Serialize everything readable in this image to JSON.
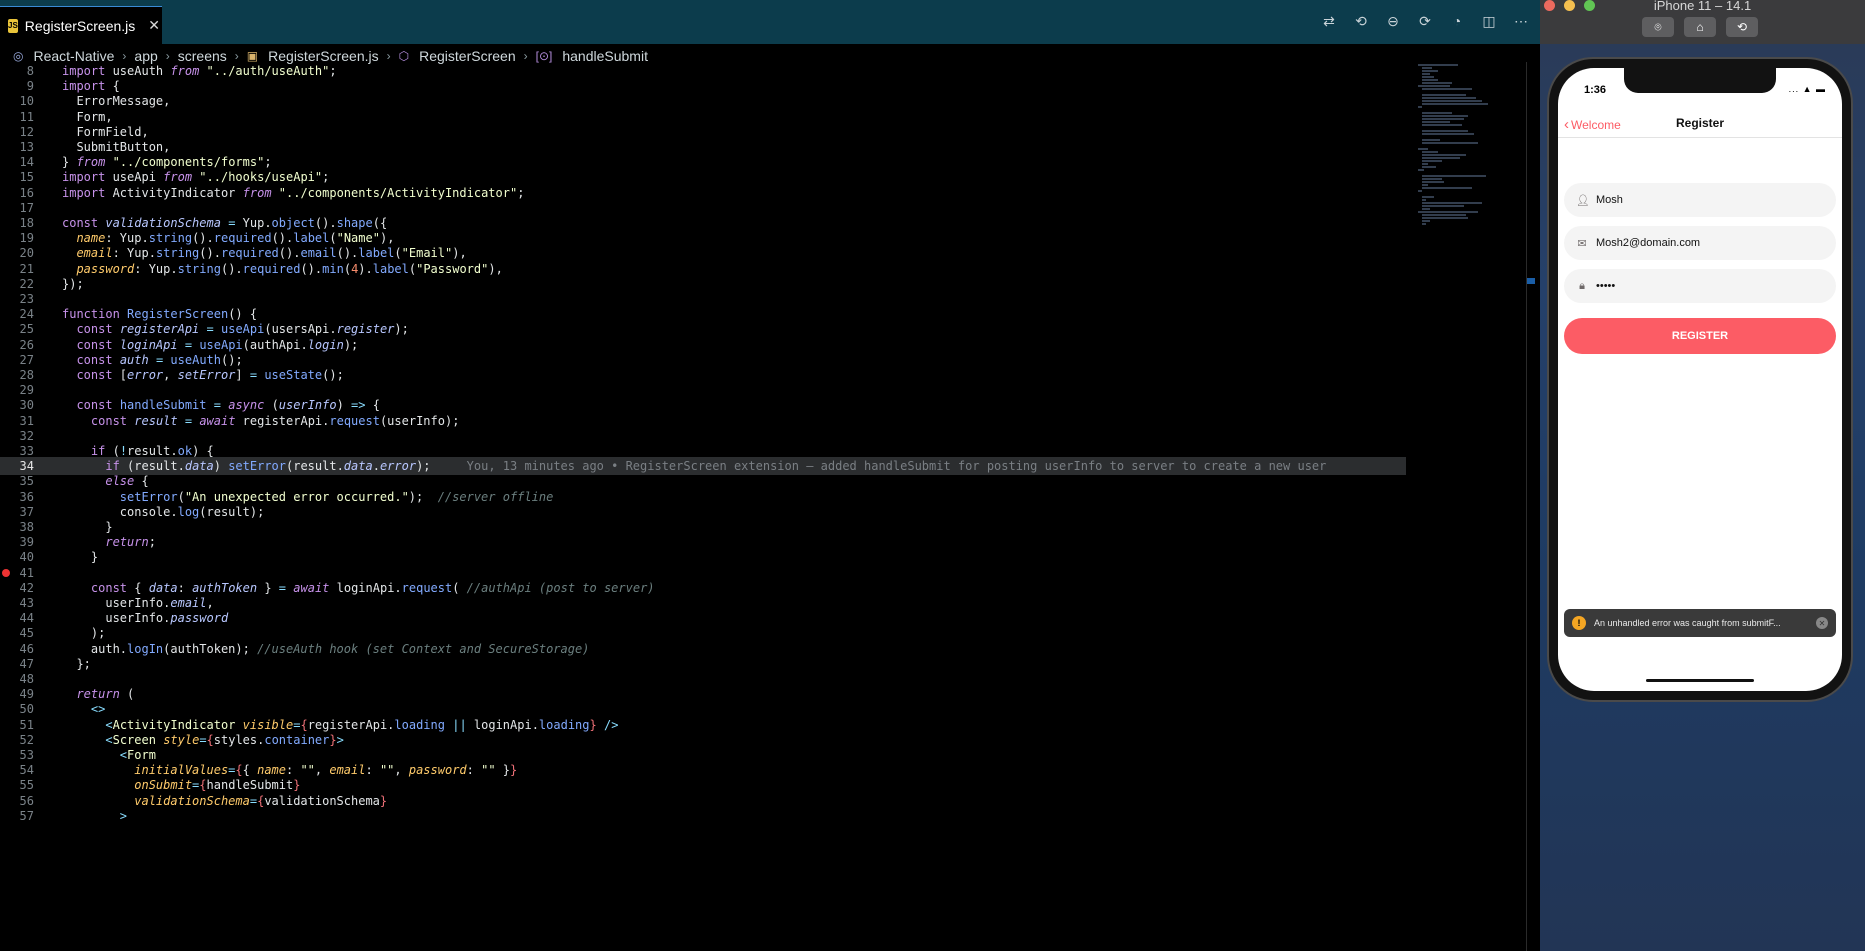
{
  "editor": {
    "tab": {
      "label": "RegisterScreen.js",
      "icon": "js-file-icon"
    },
    "breadcrumb": [
      "React-Native",
      "app",
      "screens",
      "RegisterScreen.js",
      "RegisterScreen",
      "handleSubmit"
    ],
    "lines": [
      {
        "n": "8",
        "html": "<span class=\"kw2\">import</span> useAuth <span class=\"kw\">from</span> <span class=\"str\">\"../auth/useAuth\"</span>;"
      },
      {
        "n": "9",
        "html": "<span class=\"kw2\">import</span> {"
      },
      {
        "n": "10",
        "html": "  ErrorMessage,"
      },
      {
        "n": "11",
        "html": "  Form,"
      },
      {
        "n": "12",
        "html": "  FormField,"
      },
      {
        "n": "13",
        "html": "  SubmitButton,"
      },
      {
        "n": "14",
        "html": "} <span class=\"kw\">from</span> <span class=\"str\">\"../components/forms\"</span>;"
      },
      {
        "n": "15",
        "html": "<span class=\"kw2\">import</span> useApi <span class=\"kw\">from</span> <span class=\"str\">\"../hooks/useApi\"</span>;"
      },
      {
        "n": "16",
        "html": "<span class=\"kw2\">import</span> ActivityIndicator <span class=\"kw\">from</span> <span class=\"str\">\"../components/ActivityIndicator\"</span>;"
      },
      {
        "n": "17",
        "html": ""
      },
      {
        "n": "18",
        "html": "<span class=\"kw2\">const</span> <span class=\"var\">validationSchema</span> <span class=\"pn\">=</span> Yup.<span class=\"fn\">object</span>().<span class=\"fn\">shape</span>({"
      },
      {
        "n": "19",
        "html": "  <span class=\"prop\">name</span>: Yup.<span class=\"fn\">string</span>().<span class=\"fn\">required</span>().<span class=\"fn\">label</span>(<span class=\"str\">\"Name\"</span>),"
      },
      {
        "n": "20",
        "html": "  <span class=\"prop\">email</span>: Yup.<span class=\"fn\">string</span>().<span class=\"fn\">required</span>().<span class=\"fn\">email</span>().<span class=\"fn\">label</span>(<span class=\"str\">\"Email\"</span>),"
      },
      {
        "n": "21",
        "html": "  <span class=\"prop\">password</span>: Yup.<span class=\"fn\">string</span>().<span class=\"fn\">required</span>().<span class=\"fn\">min</span>(<span class=\"num\">4</span>).<span class=\"fn\">label</span>(<span class=\"str\">\"Password\"</span>),"
      },
      {
        "n": "22",
        "html": "});"
      },
      {
        "n": "23",
        "html": ""
      },
      {
        "n": "24",
        "html": "<span class=\"kw2\">function</span> <span class=\"fn\">RegisterScreen</span>() {"
      },
      {
        "n": "25",
        "html": "  <span class=\"kw2\">const</span> <span class=\"var\">registerApi</span> <span class=\"pn\">=</span> <span class=\"fn\">useApi</span>(usersApi.<span class=\"var\">register</span>);"
      },
      {
        "n": "26",
        "html": "  <span class=\"kw2\">const</span> <span class=\"var\">loginApi</span> <span class=\"pn\">=</span> <span class=\"fn\">useApi</span>(authApi.<span class=\"var\">login</span>);"
      },
      {
        "n": "27",
        "html": "  <span class=\"kw2\">const</span> <span class=\"var\">auth</span> <span class=\"pn\">=</span> <span class=\"fn\">useAuth</span>();"
      },
      {
        "n": "28",
        "html": "  <span class=\"kw2\">const</span> [<span class=\"var\">error</span>, <span class=\"var\">setError</span>] <span class=\"pn\">=</span> <span class=\"fn\">useState</span>();"
      },
      {
        "n": "29",
        "html": ""
      },
      {
        "n": "30",
        "html": "  <span class=\"kw2\">const</span> <span class=\"fn\">handleSubmit</span> <span class=\"pn\">=</span> <span class=\"kw\">async</span> (<span class=\"var\">userInfo</span>) <span class=\"pn\">=&gt;</span> {"
      },
      {
        "n": "31",
        "html": "    <span class=\"kw2\">const</span> <span class=\"var\">result</span> <span class=\"pn\">=</span> <span class=\"kw\">await</span> registerApi.<span class=\"fn\">request</span>(userInfo);"
      },
      {
        "n": "32",
        "html": ""
      },
      {
        "n": "33",
        "html": "    <span class=\"kw2\">if</span> (<span class=\"pn\">!</span>result.<span class=\"fn\">ok</span>) {"
      },
      {
        "n": "34",
        "html": "      <span class=\"kw2\">if</span> (result.<span class=\"var\">data</span>) <span class=\"fn\">setError</span>(result.<span class=\"var\">data</span>.<span class=\"var\">error</span>);     <span class=\"blame\">You, 13 minutes ago • RegisterScreen extension – added handleSubmit for posting userInfo to server to create a new user</span>",
        "hl": true
      },
      {
        "n": "35",
        "html": "      <span class=\"kw\">else</span> {"
      },
      {
        "n": "36",
        "html": "        <span class=\"fn\">setError</span>(<span class=\"str\">\"An unexpected error occurred.\"</span>);  <span class=\"cmt\">//server offline</span>"
      },
      {
        "n": "37",
        "html": "        console.<span class=\"fn\">log</span>(result);"
      },
      {
        "n": "38",
        "html": "      }"
      },
      {
        "n": "39",
        "html": "      <span class=\"kw\">return</span>;"
      },
      {
        "n": "40",
        "html": "    }"
      },
      {
        "n": "41",
        "html": "",
        "bp": true
      },
      {
        "n": "42",
        "html": "    <span class=\"kw2\">const</span> { <span class=\"var\">data</span>: <span class=\"var\">authToken</span> } <span class=\"pn\">=</span> <span class=\"kw\">await</span> loginApi.<span class=\"fn\">request</span>( <span class=\"cmt\">//authApi (post to server)</span>"
      },
      {
        "n": "43",
        "html": "      userInfo.<span class=\"var\">email</span>,"
      },
      {
        "n": "44",
        "html": "      userInfo.<span class=\"var\">password</span>"
      },
      {
        "n": "45",
        "html": "    );"
      },
      {
        "n": "46",
        "html": "    auth.<span class=\"fn\">logIn</span>(authToken); <span class=\"cmt\">//useAuth hook (set Context and SecureStorage)</span>"
      },
      {
        "n": "47",
        "html": "  };"
      },
      {
        "n": "48",
        "html": ""
      },
      {
        "n": "49",
        "html": "  <span class=\"kw\">return</span> ("
      },
      {
        "n": "50",
        "html": "    <span class=\"pn\">&lt;&gt;</span>"
      },
      {
        "n": "51",
        "html": "      <span class=\"pn\">&lt;</span><span class=\"str\">ActivityIndicator</span> <span class=\"attr\">visible</span><span class=\"pn\">=</span><span class=\"tag\">{</span>registerApi.<span class=\"fn\">loading</span> <span class=\"pn\">||</span> loginApi.<span class=\"fn\">loading</span><span class=\"tag\">}</span> <span class=\"pn\">/&gt;</span>"
      },
      {
        "n": "52",
        "html": "      <span class=\"pn\">&lt;</span><span class=\"str\">Screen</span> <span class=\"attr\">style</span><span class=\"pn\">=</span><span class=\"tag\">{</span>styles.<span class=\"fn\">container</span><span class=\"tag\">}</span><span class=\"pn\">&gt;</span>"
      },
      {
        "n": "53",
        "html": "        <span class=\"pn\">&lt;</span><span class=\"str\">Form</span>"
      },
      {
        "n": "54",
        "html": "          <span class=\"attr\">initialValues</span><span class=\"pn\">=</span><span class=\"tag\">{</span>{ <span class=\"prop\">name</span>: <span class=\"str\">\"\"</span>, <span class=\"prop\">email</span>: <span class=\"str\">\"\"</span>, <span class=\"prop\">password</span>: <span class=\"str\">\"\"</span> }<span class=\"tag\">}</span>"
      },
      {
        "n": "55",
        "html": "          <span class=\"attr\">onSubmit</span><span class=\"pn\">=</span><span class=\"tag\">{</span>handleSubmit<span class=\"tag\">}</span>"
      },
      {
        "n": "56",
        "html": "          <span class=\"attr\">validationSchema</span><span class=\"pn\">=</span><span class=\"tag\">{</span>validationSchema<span class=\"tag\">}</span>"
      },
      {
        "n": "57",
        "html": "        <span class=\"pn\">&gt;</span>"
      }
    ]
  },
  "simulator": {
    "title": "iPhone 11 – 14.1",
    "screenshot_button": "⌾",
    "home_button": "⌂",
    "rotate_button": "⟲"
  },
  "app": {
    "status_time": "1:36",
    "status_icons": "... ▲ ▬",
    "nav": {
      "back": "Welcome",
      "title": "Register"
    },
    "fields": {
      "name": {
        "value": "Mosh",
        "icon": "account-icon"
      },
      "email": {
        "value": "Mosh2@domain.com",
        "icon": "email-icon"
      },
      "password": {
        "value": "•••••",
        "icon": "lock-icon"
      }
    },
    "register_label": "REGISTER",
    "toast": {
      "text": "An unhandled error was caught from submitF..."
    }
  },
  "colors": {
    "primary": "#fc5c65",
    "editor_bg": "#000000",
    "tab_bar": "#0c3c4c"
  }
}
